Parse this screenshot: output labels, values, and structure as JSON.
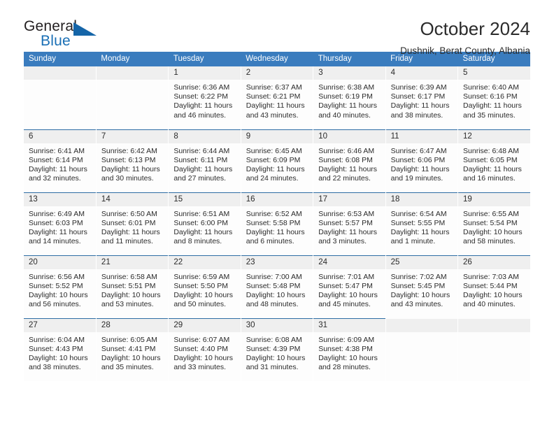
{
  "logo": {
    "word_one": "General",
    "word_two": "Blue",
    "triangle_color": "#1565a8",
    "blue_color": "#1a6fb5"
  },
  "header": {
    "title": "October 2024",
    "subtitle": "Dushnik, Berat County, Albania"
  },
  "theme": {
    "header_blue": "#3a7cbe",
    "rule_blue": "#2e6da4",
    "daynum_gray": "#efefef"
  },
  "calendar": {
    "weekday_headers": [
      "Sunday",
      "Monday",
      "Tuesday",
      "Wednesday",
      "Thursday",
      "Friday",
      "Saturday"
    ],
    "weeks": [
      [
        {
          "day": "",
          "lines": []
        },
        {
          "day": "",
          "lines": []
        },
        {
          "day": "1",
          "lines": [
            "Sunrise: 6:36 AM",
            "Sunset: 6:22 PM",
            "Daylight: 11 hours",
            "and 46 minutes."
          ]
        },
        {
          "day": "2",
          "lines": [
            "Sunrise: 6:37 AM",
            "Sunset: 6:21 PM",
            "Daylight: 11 hours",
            "and 43 minutes."
          ]
        },
        {
          "day": "3",
          "lines": [
            "Sunrise: 6:38 AM",
            "Sunset: 6:19 PM",
            "Daylight: 11 hours",
            "and 40 minutes."
          ]
        },
        {
          "day": "4",
          "lines": [
            "Sunrise: 6:39 AM",
            "Sunset: 6:17 PM",
            "Daylight: 11 hours",
            "and 38 minutes."
          ]
        },
        {
          "day": "5",
          "lines": [
            "Sunrise: 6:40 AM",
            "Sunset: 6:16 PM",
            "Daylight: 11 hours",
            "and 35 minutes."
          ]
        }
      ],
      [
        {
          "day": "6",
          "lines": [
            "Sunrise: 6:41 AM",
            "Sunset: 6:14 PM",
            "Daylight: 11 hours",
            "and 32 minutes."
          ]
        },
        {
          "day": "7",
          "lines": [
            "Sunrise: 6:42 AM",
            "Sunset: 6:13 PM",
            "Daylight: 11 hours",
            "and 30 minutes."
          ]
        },
        {
          "day": "8",
          "lines": [
            "Sunrise: 6:44 AM",
            "Sunset: 6:11 PM",
            "Daylight: 11 hours",
            "and 27 minutes."
          ]
        },
        {
          "day": "9",
          "lines": [
            "Sunrise: 6:45 AM",
            "Sunset: 6:09 PM",
            "Daylight: 11 hours",
            "and 24 minutes."
          ]
        },
        {
          "day": "10",
          "lines": [
            "Sunrise: 6:46 AM",
            "Sunset: 6:08 PM",
            "Daylight: 11 hours",
            "and 22 minutes."
          ]
        },
        {
          "day": "11",
          "lines": [
            "Sunrise: 6:47 AM",
            "Sunset: 6:06 PM",
            "Daylight: 11 hours",
            "and 19 minutes."
          ]
        },
        {
          "day": "12",
          "lines": [
            "Sunrise: 6:48 AM",
            "Sunset: 6:05 PM",
            "Daylight: 11 hours",
            "and 16 minutes."
          ]
        }
      ],
      [
        {
          "day": "13",
          "lines": [
            "Sunrise: 6:49 AM",
            "Sunset: 6:03 PM",
            "Daylight: 11 hours",
            "and 14 minutes."
          ]
        },
        {
          "day": "14",
          "lines": [
            "Sunrise: 6:50 AM",
            "Sunset: 6:01 PM",
            "Daylight: 11 hours",
            "and 11 minutes."
          ]
        },
        {
          "day": "15",
          "lines": [
            "Sunrise: 6:51 AM",
            "Sunset: 6:00 PM",
            "Daylight: 11 hours",
            "and 8 minutes."
          ]
        },
        {
          "day": "16",
          "lines": [
            "Sunrise: 6:52 AM",
            "Sunset: 5:58 PM",
            "Daylight: 11 hours",
            "and 6 minutes."
          ]
        },
        {
          "day": "17",
          "lines": [
            "Sunrise: 6:53 AM",
            "Sunset: 5:57 PM",
            "Daylight: 11 hours",
            "and 3 minutes."
          ]
        },
        {
          "day": "18",
          "lines": [
            "Sunrise: 6:54 AM",
            "Sunset: 5:55 PM",
            "Daylight: 11 hours",
            "and 1 minute."
          ]
        },
        {
          "day": "19",
          "lines": [
            "Sunrise: 6:55 AM",
            "Sunset: 5:54 PM",
            "Daylight: 10 hours",
            "and 58 minutes."
          ]
        }
      ],
      [
        {
          "day": "20",
          "lines": [
            "Sunrise: 6:56 AM",
            "Sunset: 5:52 PM",
            "Daylight: 10 hours",
            "and 56 minutes."
          ]
        },
        {
          "day": "21",
          "lines": [
            "Sunrise: 6:58 AM",
            "Sunset: 5:51 PM",
            "Daylight: 10 hours",
            "and 53 minutes."
          ]
        },
        {
          "day": "22",
          "lines": [
            "Sunrise: 6:59 AM",
            "Sunset: 5:50 PM",
            "Daylight: 10 hours",
            "and 50 minutes."
          ]
        },
        {
          "day": "23",
          "lines": [
            "Sunrise: 7:00 AM",
            "Sunset: 5:48 PM",
            "Daylight: 10 hours",
            "and 48 minutes."
          ]
        },
        {
          "day": "24",
          "lines": [
            "Sunrise: 7:01 AM",
            "Sunset: 5:47 PM",
            "Daylight: 10 hours",
            "and 45 minutes."
          ]
        },
        {
          "day": "25",
          "lines": [
            "Sunrise: 7:02 AM",
            "Sunset: 5:45 PM",
            "Daylight: 10 hours",
            "and 43 minutes."
          ]
        },
        {
          "day": "26",
          "lines": [
            "Sunrise: 7:03 AM",
            "Sunset: 5:44 PM",
            "Daylight: 10 hours",
            "and 40 minutes."
          ]
        }
      ],
      [
        {
          "day": "27",
          "lines": [
            "Sunrise: 6:04 AM",
            "Sunset: 4:43 PM",
            "Daylight: 10 hours",
            "and 38 minutes."
          ]
        },
        {
          "day": "28",
          "lines": [
            "Sunrise: 6:05 AM",
            "Sunset: 4:41 PM",
            "Daylight: 10 hours",
            "and 35 minutes."
          ]
        },
        {
          "day": "29",
          "lines": [
            "Sunrise: 6:07 AM",
            "Sunset: 4:40 PM",
            "Daylight: 10 hours",
            "and 33 minutes."
          ]
        },
        {
          "day": "30",
          "lines": [
            "Sunrise: 6:08 AM",
            "Sunset: 4:39 PM",
            "Daylight: 10 hours",
            "and 31 minutes."
          ]
        },
        {
          "day": "31",
          "lines": [
            "Sunrise: 6:09 AM",
            "Sunset: 4:38 PM",
            "Daylight: 10 hours",
            "and 28 minutes."
          ]
        },
        {
          "day": "",
          "lines": []
        },
        {
          "day": "",
          "lines": []
        }
      ]
    ]
  }
}
